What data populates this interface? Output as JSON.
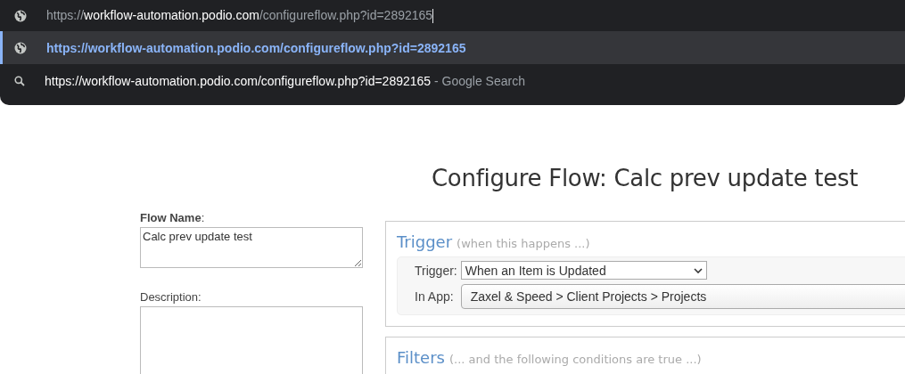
{
  "address_bar": {
    "scheme": "https://",
    "host": "workflow-automation.podio.com",
    "path": "/configureflow.php?id=2892165"
  },
  "suggestions": [
    {
      "kind": "url",
      "selected": true,
      "text": "https://workflow-automation.podio.com/configureflow.php?id=2892165"
    },
    {
      "kind": "search",
      "selected": false,
      "text": "https://workflow-automation.podio.com/configureflow.php?id=2892165",
      "suffix": "- Google Search"
    }
  ],
  "page_title": "Configure Flow: Calc prev update test",
  "flow_name": {
    "label": "Flow Name",
    "colon": ":",
    "value": "Calc prev update test"
  },
  "description": {
    "label": "Description:"
  },
  "trigger_panel": {
    "title": "Trigger",
    "hint": "(when this happens ...)",
    "fields": [
      {
        "label": "Trigger:",
        "kind": "dropdown",
        "value": "When an Item is Updated"
      },
      {
        "label": "In App:",
        "kind": "picker",
        "value": "Zaxel & Speed > Client Projects > Projects"
      }
    ]
  },
  "filters_panel": {
    "title": "Filters",
    "hint": "(... and the following conditions are true ...)"
  }
}
